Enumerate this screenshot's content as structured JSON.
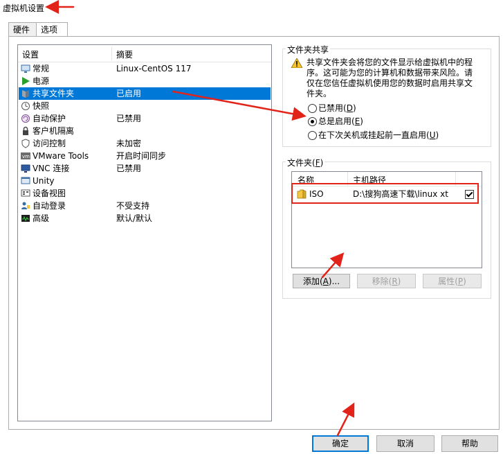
{
  "window": {
    "title": "虚拟机设置"
  },
  "tabs": [
    {
      "label": "硬件",
      "active": false
    },
    {
      "label": "选项",
      "active": true
    }
  ],
  "settings_list": {
    "col_setting": "设置",
    "col_summary": "摘要",
    "items": [
      {
        "name": "常规",
        "summary": "Linux-CentOS 117",
        "icon": "monitor-icon",
        "selected": false
      },
      {
        "name": "电源",
        "summary": "",
        "icon": "power-play-icon",
        "selected": false
      },
      {
        "name": "共享文件夹",
        "summary": "已启用",
        "icon": "shared-folder-icon",
        "selected": true
      },
      {
        "name": "快照",
        "summary": "",
        "icon": "snapshot-icon",
        "selected": false
      },
      {
        "name": "自动保护",
        "summary": "已禁用",
        "icon": "autoprotect-icon",
        "selected": false
      },
      {
        "name": "客户机隔离",
        "summary": "",
        "icon": "lock-icon",
        "selected": false
      },
      {
        "name": "访问控制",
        "summary": "未加密",
        "icon": "access-control-icon",
        "selected": false
      },
      {
        "name": "VMware Tools",
        "summary": "开启时间同步",
        "icon": "vmware-tools-icon",
        "selected": false
      },
      {
        "name": "VNC 连接",
        "summary": "已禁用",
        "icon": "vnc-icon",
        "selected": false
      },
      {
        "name": "Unity",
        "summary": "",
        "icon": "unity-icon",
        "selected": false
      },
      {
        "name": "设备视图",
        "summary": "",
        "icon": "device-view-icon",
        "selected": false
      },
      {
        "name": "自动登录",
        "summary": "不受支持",
        "icon": "autologin-icon",
        "selected": false
      },
      {
        "name": "高级",
        "summary": "默认/默认",
        "icon": "advanced-icon",
        "selected": false
      }
    ]
  },
  "folder_sharing": {
    "group_title": "文件夹共享",
    "warning": "共享文件夹会将您的文件显示给虚拟机中的程序。这可能为您的计算机和数据带来风险。请仅在您信任虚拟机使用您的数据时启用共享文件夹。",
    "options": [
      {
        "label": "已禁用",
        "key": "D",
        "checked": false
      },
      {
        "label": "总是启用",
        "key": "E",
        "checked": true
      },
      {
        "label": "在下次关机或挂起前一直启用",
        "key": "U",
        "checked": false
      }
    ]
  },
  "folders": {
    "group_title": "文件夹",
    "group_key": "F",
    "col_name": "名称",
    "col_path": "主机路径",
    "rows": [
      {
        "name": "ISO",
        "path": "D:\\搜狗高速下载\\linux xt",
        "enabled": true
      }
    ],
    "add_label": "添加",
    "add_key": "A",
    "add_suffix": "...",
    "remove_label": "移除",
    "remove_key": "R",
    "props_label": "属性",
    "props_key": "P"
  },
  "footer": {
    "ok_label": "确定",
    "cancel_label": "取消",
    "help_label": "帮助"
  },
  "colors": {
    "selection": "#0078d7",
    "annotation": "#e2231a"
  }
}
